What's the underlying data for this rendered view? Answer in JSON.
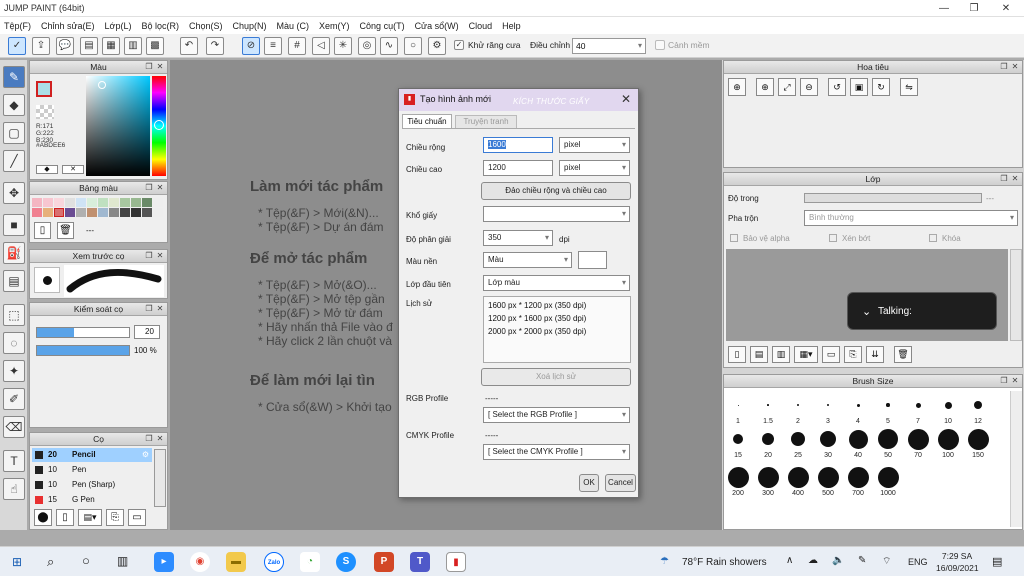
{
  "app": {
    "title": "JUMP PAINT (64bit)"
  },
  "window_controls": {
    "minimize": "—",
    "restore": "❐",
    "close": "✕"
  },
  "menu": [
    "Tệp(F)",
    "Chỉnh sửa(E)",
    "Lớp(L)",
    "Bộ lọc(R)",
    "Chọn(S)",
    "Chụp(N)",
    "Màu (C)",
    "Xem(Y)",
    "Công cụ(T)",
    "Cửa sổ(W)",
    "Cloud",
    "Help"
  ],
  "toolbar": {
    "antialias_label": "Khử răng cưa",
    "adjust_label": "Điều chỉnh",
    "adjust_value": "40",
    "warning_label": "Cảnh mềm"
  },
  "color_panel": {
    "title": "Màu",
    "r": "R:171",
    "g": "G:222",
    "b": "B:230",
    "hex": "#ABDEE6",
    "accent": "#ABDEE6"
  },
  "palette_panel": {
    "title": "Bảng màu",
    "dash": "---"
  },
  "brush_preview": {
    "title": "Xem trước cọ"
  },
  "brush_control": {
    "title": "Kiểm soát cọ",
    "size": "20",
    "opacity": "100 %"
  },
  "brush_panel": {
    "title": "Cọ",
    "items": [
      {
        "size": "20",
        "name": "Pencil",
        "color": "#222222"
      },
      {
        "size": "10",
        "name": "Pen",
        "color": "#222222"
      },
      {
        "size": "10",
        "name": "Pen (Sharp)",
        "color": "#222222"
      },
      {
        "size": "15",
        "name": "G Pen",
        "color": "#e83030"
      }
    ]
  },
  "document": {
    "h1": "Làm mới tác phẩm",
    "l1": "* Tệp(&F) > Mới(&N)...",
    "l2": "* Tệp(&F) > Dự án đám",
    "h2": "Để mở tác phẩm",
    "l3": "* Tệp(&F) > Mở(&O)...",
    "l4": "* Tệp(&F) > Mở tệp gần",
    "l5": "* Tệp(&F) > Mở từ đám",
    "l6": "* Hãy nhấn thả File vào đ",
    "l7": "* Hãy click 2 lần chuột và",
    "h3": "Để làm mới lại tìn",
    "l8": "* Cửa sổ(&W) > Khởi tạo"
  },
  "navigator_panel": {
    "title": "Hoa tiêu"
  },
  "layer_panel": {
    "title": "Lớp",
    "opacity_label": "Độ trong",
    "opacity_value": "---",
    "blend_label": "Pha trộn",
    "blend_value": "Bình thường",
    "protect_alpha": "Bảo vệ alpha",
    "clipping": "Xén bớt",
    "lock": "Khóa"
  },
  "talking": {
    "text": "Talking:"
  },
  "brush_size_panel": {
    "title": "Brush Size",
    "row1": [
      "1",
      "1.5",
      "2",
      "3",
      "4",
      "5",
      "7",
      "10",
      "12"
    ],
    "row2": [
      "15",
      "20",
      "25",
      "30",
      "40",
      "50",
      "70",
      "100",
      "150"
    ],
    "row3": [
      "200",
      "300",
      "400",
      "500",
      "700",
      "1000"
    ]
  },
  "dialog": {
    "title": "Tạo hình ảnh mới",
    "watermark": "KÍCH THƯỚC GIẤY",
    "tab_standard": "Tiêu chuẩn",
    "tab_comic": "Truyện tranh",
    "width_label": "Chiều rộng",
    "width_value": "1600",
    "width_unit": "pixel",
    "height_label": "Chiều cao",
    "height_value": "1200",
    "height_unit": "pixel",
    "swap_button": "Đảo chiều rộng và chiều cao",
    "paper_label": "Khổ giấy",
    "paper_value": "",
    "resolution_label": "Độ phân giải",
    "resolution_value": "350",
    "resolution_unit": "dpi",
    "bg_label": "Màu nền",
    "bg_value": "Màu",
    "first_layer_label": "Lớp đầu tiên",
    "first_layer_value": "Lớp màu",
    "history_label": "Lịch sử",
    "history": [
      "1600 px * 1200 px (350 dpi)",
      "1200 px * 1600 px (350 dpi)",
      "2000 px * 2000 px (350 dpi)"
    ],
    "clear_history": "Xoá lịch sử",
    "rgb_label": "RGB Profile",
    "rgb_dash": "-----",
    "rgb_value": "[ Select the RGB Profile ]",
    "cmyk_label": "CMYK Profile",
    "cmyk_dash": "-----",
    "cmyk_value": "[ Select the CMYK Profile ]",
    "ok": "OK",
    "cancel": "Cancel"
  },
  "taskbar": {
    "weather": "78°F  Rain showers",
    "lang": "ENG",
    "time": "7:29 SA",
    "date": "16/09/2021",
    "zalo": "Zalo"
  }
}
